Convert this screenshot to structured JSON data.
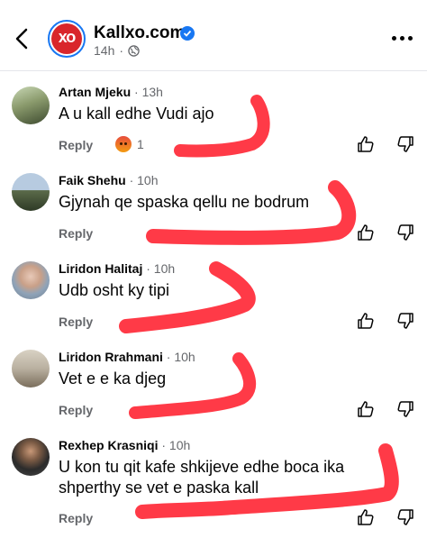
{
  "header": {
    "page_name": "Kallxo.com",
    "avatar_text": "XO",
    "time": "14h",
    "separator": "·",
    "colors": {
      "brand": "#d9262b",
      "verified": "#1877f2"
    },
    "icons": [
      "back-arrow-icon",
      "verified-badge-icon",
      "globe-icon",
      "more-options-icon"
    ]
  },
  "comments": [
    {
      "author": "Artan Mjeku",
      "time": "· 13h",
      "text": "A u kall edhe Vudi ajo",
      "reply": "Reply",
      "reaction_count": "1",
      "reaction_icon": "angry-reaction-icon"
    },
    {
      "author": "Faik Shehu",
      "time": "· 10h",
      "text": "Gjynah qe spaska qellu ne bodrum",
      "reply": "Reply"
    },
    {
      "author": "Liridon Halitaj",
      "time": "· 10h",
      "text": "Udb osht ky tipi",
      "reply": "Reply"
    },
    {
      "author": "Liridon Rrahmani",
      "time": "· 10h",
      "text": "Vet e e ka djeg",
      "reply": "Reply"
    },
    {
      "author": "Rexhep Krasniqi",
      "time": "· 10h",
      "text": "U kon tu qit kafe shkijeve edhe boca ika shperthy se vet e paska kall",
      "reply": "Reply"
    }
  ],
  "annotation_color": "#ff1f2d"
}
